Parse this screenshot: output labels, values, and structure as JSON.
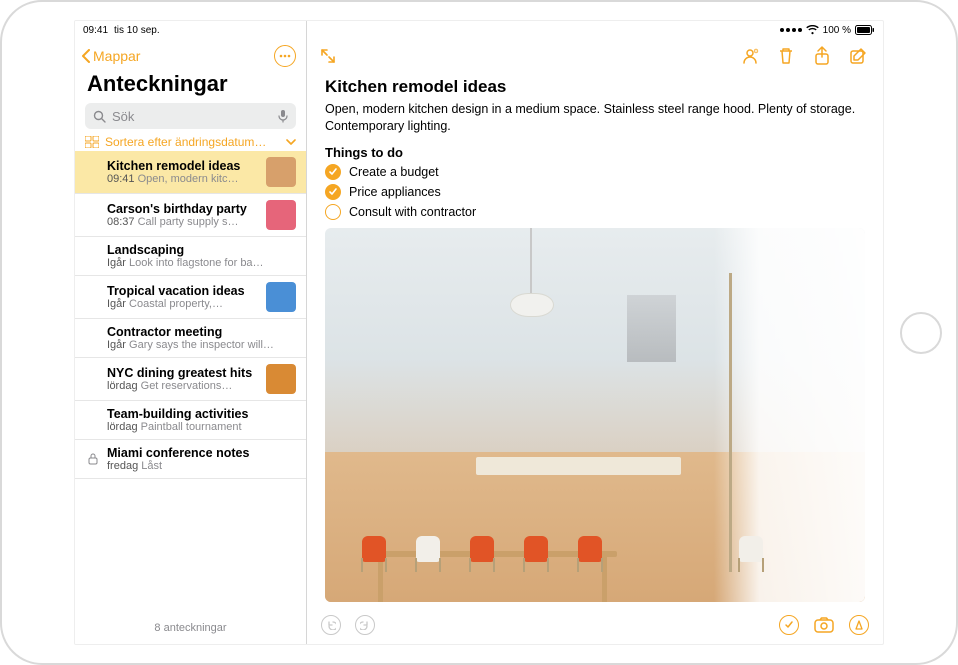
{
  "status": {
    "time": "09:41",
    "date": "tis 10 sep.",
    "battery_pct": "100 %"
  },
  "sidebar": {
    "back_label": "Mappar",
    "title": "Anteckningar",
    "search_placeholder": "Sök",
    "sort_label": "Sortera efter ändringsdatum…",
    "footer": "8 anteckningar"
  },
  "notes": [
    {
      "title": "Kitchen remodel ideas",
      "time": "09:41",
      "snippet": "Open, modern kitc…",
      "has_thumb": true,
      "selected": true,
      "locked": false,
      "thumb_color": "#d7a06b"
    },
    {
      "title": "Carson's birthday party",
      "time": "08:37",
      "snippet": "Call party supply s…",
      "has_thumb": true,
      "selected": false,
      "locked": false,
      "thumb_color": "#e6657a"
    },
    {
      "title": "Landscaping",
      "time": "Igår",
      "snippet": "Look into flagstone for ba…",
      "has_thumb": false,
      "selected": false,
      "locked": false
    },
    {
      "title": "Tropical vacation ideas",
      "time": "Igår",
      "snippet": "Coastal property,…",
      "has_thumb": true,
      "selected": false,
      "locked": false,
      "thumb_color": "#4a8fd6"
    },
    {
      "title": "Contractor meeting",
      "time": "Igår",
      "snippet": "Gary says the inspector will…",
      "has_thumb": false,
      "selected": false,
      "locked": false
    },
    {
      "title": "NYC dining greatest hits",
      "time": "lördag",
      "snippet": "Get reservations…",
      "has_thumb": true,
      "selected": false,
      "locked": false,
      "thumb_color": "#d98a34"
    },
    {
      "title": "Team-building activities",
      "time": "lördag",
      "snippet": "Paintball tournament",
      "has_thumb": false,
      "selected": false,
      "locked": false
    },
    {
      "title": "Miami conference notes",
      "time": "fredag",
      "snippet": "Låst",
      "has_thumb": false,
      "selected": false,
      "locked": true
    }
  ],
  "note": {
    "title": "Kitchen remodel ideas",
    "body": "Open, modern kitchen design in a medium space. Stainless steel range hood. Plenty of storage. Contemporary lighting.",
    "checklist_header": "Things to do",
    "items": [
      {
        "label": "Create a budget",
        "checked": true
      },
      {
        "label": "Price appliances",
        "checked": true
      },
      {
        "label": "Consult with contractor",
        "checked": false
      }
    ]
  },
  "colors": {
    "accent": "#f5a623"
  }
}
